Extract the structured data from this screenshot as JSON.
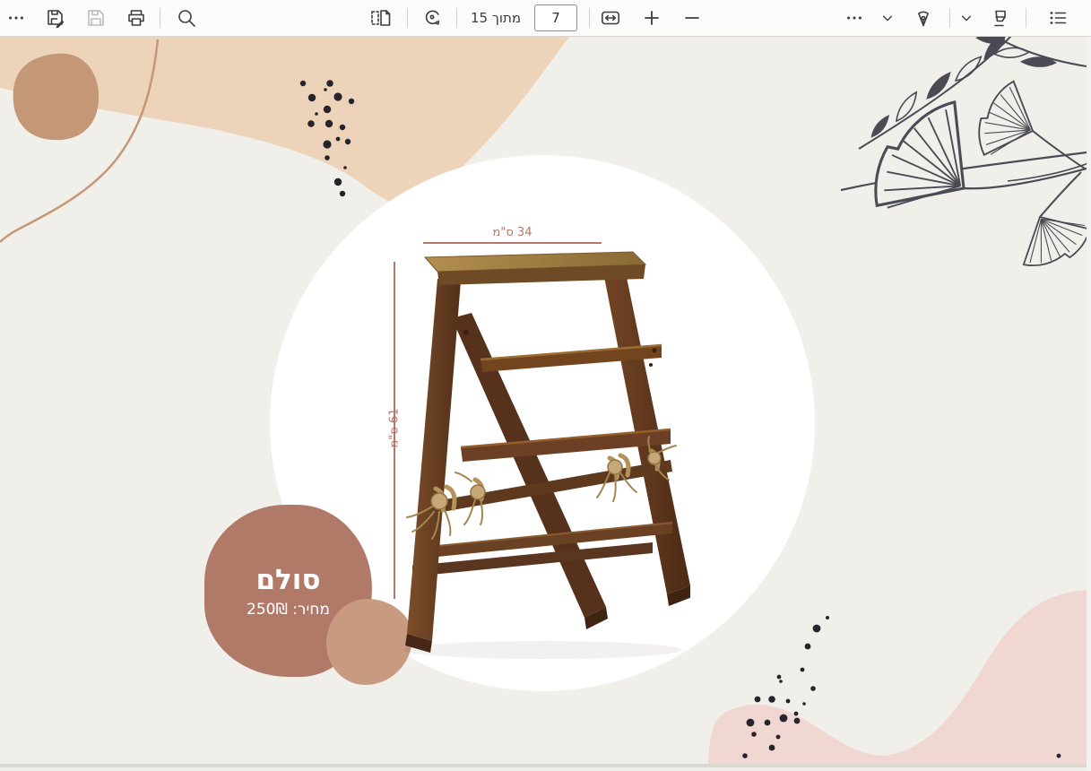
{
  "toolbar": {
    "page_input": "7",
    "page_count_label": "מתוך 15",
    "icons": [
      "more-actions",
      "save-as",
      "save",
      "print",
      "search",
      "page-view",
      "rotate",
      "fit-to-width",
      "zoom-in",
      "zoom-out",
      "draw-menu",
      "draw",
      "highlight-menu",
      "highlight",
      "contents"
    ]
  },
  "document": {
    "width_dimension": "34 ס\"מ",
    "height_dimension": "61 ס\"מ",
    "product_title": "סולם",
    "product_price": "מחיר: 250₪"
  },
  "colors": {
    "accent_terracotta": "#b5766b",
    "blob_brown": "#b17a68",
    "blob_tan": "#c49877",
    "blob_light_tan": "#c89a80",
    "wave_peach": "#edd3ba",
    "wave_pink": "#f0d7d1",
    "page_background": "#f0efe9",
    "line_art": "#4b4a55",
    "dot_color": "#26242b"
  }
}
